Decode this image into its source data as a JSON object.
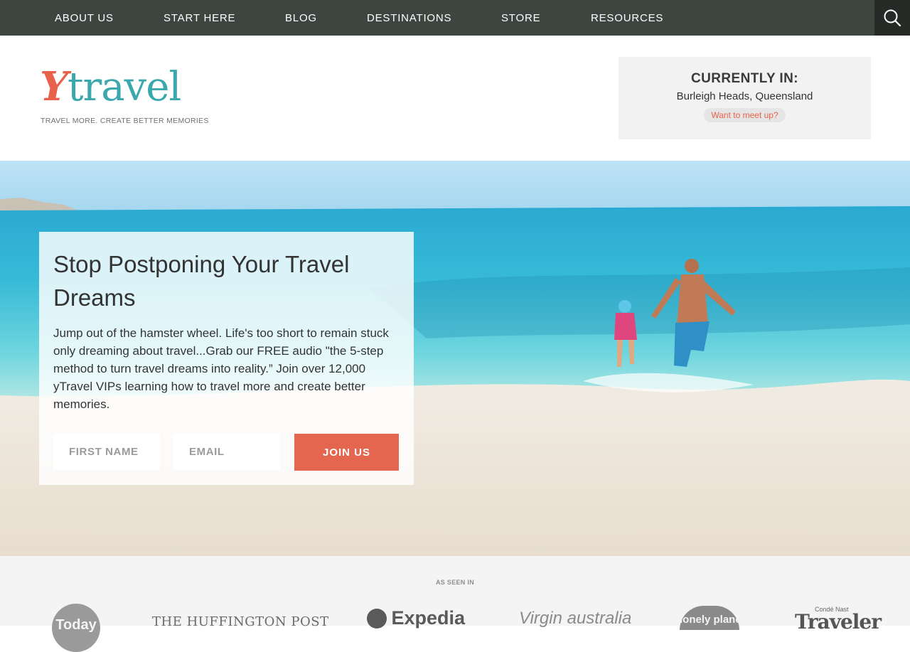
{
  "nav": {
    "items": [
      {
        "label": "ABOUT US"
      },
      {
        "label": "START HERE"
      },
      {
        "label": "BLOG"
      },
      {
        "label": "DESTINATIONS"
      },
      {
        "label": "STORE"
      },
      {
        "label": "RESOURCES"
      }
    ],
    "search_icon": "search-icon"
  },
  "header": {
    "logo": {
      "y": "Y",
      "rest": "travel",
      "tagline": "TRAVEL MORE. CREATE BETTER MEMORIES"
    },
    "current": {
      "title": "CURRENTLY IN:",
      "location": "Burleigh Heads, Queensland",
      "meetup_label": "Want to meet up?"
    }
  },
  "hero": {
    "title": "Stop Postponing Your Travel Dreams",
    "text": "Jump out of the hamster wheel. Life's too short to remain stuck only dreaming about travel...Grab our FREE audio \"the 5-step method to turn travel dreams into reality.” Join over 12,000 yTravel VIPs learning how to travel more and create better memories.",
    "first_name_placeholder": "FIRST NAME",
    "email_placeholder": "EMAIL",
    "join_label": "JOIN US"
  },
  "as_seen_in": {
    "title": "AS SEEN IN",
    "brands": [
      "Today",
      "THE HUFFINGTON POST",
      "Expedia",
      "Virgin australia",
      "lonely planet",
      "Condé Nast",
      "Traveler"
    ]
  },
  "colors": {
    "nav_bg": "#3d4540",
    "accent": "#e5664f",
    "teal": "#3ba8ad"
  }
}
